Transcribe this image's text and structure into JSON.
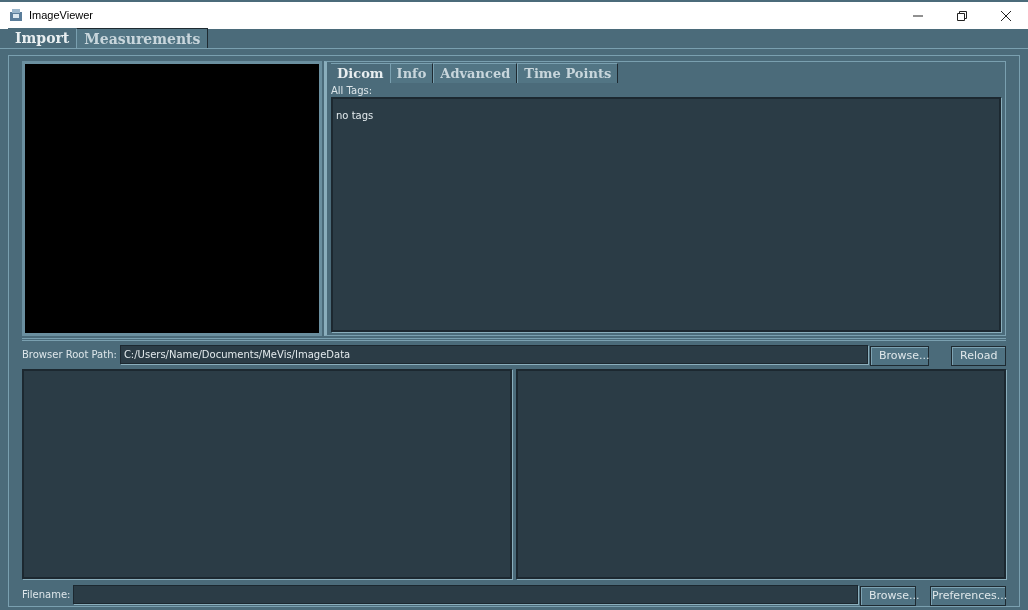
{
  "window": {
    "title": "ImageViewer"
  },
  "main_tabs": [
    {
      "label": "Import",
      "selected": true
    },
    {
      "label": "Measurements",
      "selected": false
    }
  ],
  "detail_tabs": [
    {
      "label": "Dicom",
      "selected": true
    },
    {
      "label": "Info",
      "selected": false
    },
    {
      "label": "Advanced",
      "selected": false
    },
    {
      "label": "Time Points",
      "selected": false
    }
  ],
  "tags": {
    "label": "All Tags:",
    "content": "no tags"
  },
  "browser": {
    "label": "Browser Root Path:",
    "value": "C:/Users/Name/Documents/MeVis/ImageData",
    "buttons": [
      "Browse...",
      "Reload"
    ]
  },
  "file": {
    "label": "Filename:",
    "buttons": [
      "Browse...",
      "Preferences..."
    ]
  }
}
